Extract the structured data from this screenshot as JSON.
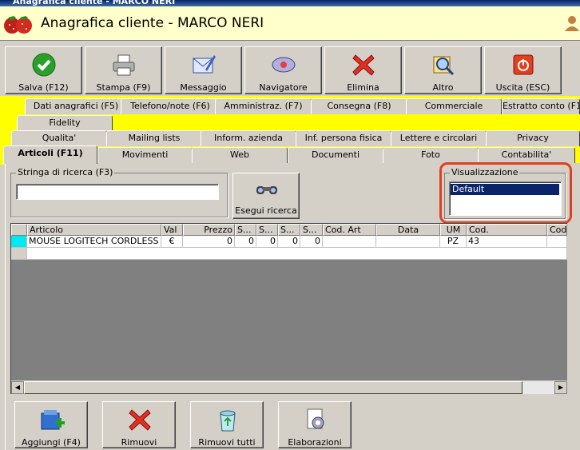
{
  "window": {
    "title": "Anagrafica cliente - MARCO NERI"
  },
  "header": {
    "title": "Anagrafica cliente - MARCO NERI"
  },
  "toolbar": [
    {
      "label": "Salva (F12)",
      "icon": "check-icon"
    },
    {
      "label": "Stampa (F9)",
      "icon": "printer-icon"
    },
    {
      "label": "Messaggio",
      "icon": "message-icon"
    },
    {
      "label": "Navigatore",
      "icon": "navigator-icon"
    },
    {
      "label": "Elimina",
      "icon": "delete-icon"
    },
    {
      "label": "Altro",
      "icon": "search-folder-icon"
    },
    {
      "label": "Uscita (ESC)",
      "icon": "exit-icon"
    }
  ],
  "tabs": {
    "row1": [
      "Dati anagrafici (F5)",
      "Telefono/note (F6)",
      "Amministraz. (F7)",
      "Consegna (F8)",
      "Commerciale",
      "Estratto conto (F1"
    ],
    "row2": [
      "Fidelity"
    ],
    "row3": [
      "Qualita'",
      "Mailing lists",
      "Inform. azienda",
      "Inf. persona fisica",
      "Lettere e circolari",
      "Privacy"
    ],
    "row4": [
      "Articoli (F11)",
      "Movimenti",
      "Web",
      "Documenti",
      "Foto",
      "Contabilita'"
    ]
  },
  "search": {
    "label": "Stringa di ricerca (F3)",
    "value": "",
    "button_label": "Esegui ricerca"
  },
  "view": {
    "label": "Visualizzazione",
    "options": [
      "Default"
    ],
    "selected": "Default",
    "highlight_color": "#e04020"
  },
  "grid": {
    "columns": [
      "Articolo",
      "Val",
      "Prezzo",
      "S...",
      "S...",
      "S...",
      "S...",
      "Cod. Art",
      "Data",
      "UM",
      "Cod.",
      "Cod."
    ],
    "rows": [
      [
        "MOUSE LOGITECH CORDLESS",
        "€",
        "0",
        "0",
        "0",
        "0",
        "0",
        "",
        "",
        "PZ",
        "43",
        ""
      ]
    ]
  },
  "bottom_buttons": [
    {
      "label": "Aggiungi (F4)",
      "icon": "add-items-icon"
    },
    {
      "label": "Rimuovi",
      "icon": "remove-icon"
    },
    {
      "label": "Rimuovi tutti",
      "icon": "recycle-bin-icon"
    },
    {
      "label": "Elaborazioni",
      "icon": "processing-icon"
    }
  ],
  "colors": {
    "header_bg": "#ffffcc",
    "tab_zone": "#ffff00",
    "title_bar": "#0a246a",
    "selected_row_marker": "#00ffff"
  }
}
